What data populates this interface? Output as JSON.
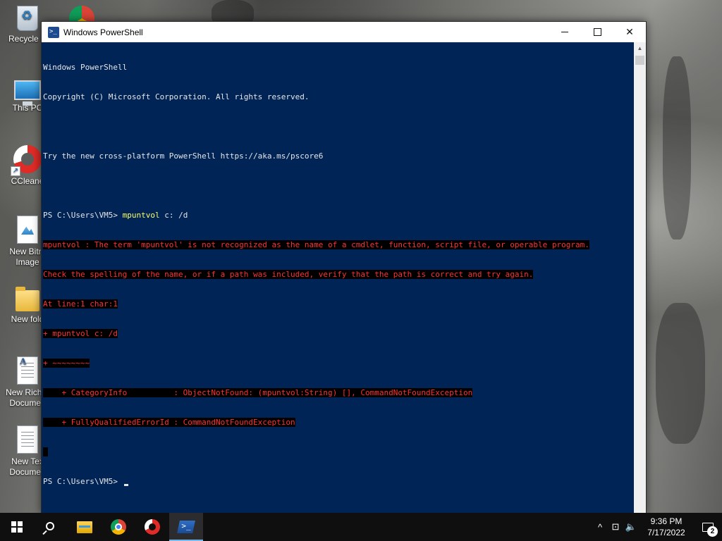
{
  "desktop": {
    "icons": [
      {
        "label": "Recycle B",
        "icon": "recycle-bin-icon"
      },
      {
        "label": "This PC",
        "icon": "computer-icon"
      },
      {
        "label": "CCleane",
        "icon": "ccleaner-icon"
      },
      {
        "label": "New Bitm\nImage",
        "icon": "bitmap-file-icon"
      },
      {
        "label": "New fold",
        "icon": "folder-icon"
      },
      {
        "label": "New Rich T\nDocumen",
        "icon": "rtf-document-icon"
      },
      {
        "label": "New Tex\nDocumen",
        "icon": "text-document-icon"
      }
    ]
  },
  "window": {
    "title": "Windows PowerShell",
    "controls": {
      "minimize": "minimize",
      "maximize": "maximize",
      "close": "✕"
    }
  },
  "console": {
    "banner_1": "Windows PowerShell",
    "banner_2": "Copyright (C) Microsoft Corporation. All rights reserved.",
    "banner_3": "",
    "banner_4": "Try the new cross-platform PowerShell https://aka.ms/pscore6",
    "banner_5": "",
    "prompt_1": "PS C:\\Users\\VM5> ",
    "command_name": "mpuntvol",
    "command_args": " c: /d",
    "error_1": "mpuntvol : The term 'mpuntvol' is not recognized as the name of a cmdlet, function, script file, or operable program.",
    "error_2": "Check the spelling of the name, or if a path was included, verify that the path is correct and try again.",
    "error_3": "At line:1 char:1",
    "error_4": "+ mpuntvol c: /d",
    "error_5": "+ ~~~~~~~~",
    "error_6": "    + CategoryInfo          : ObjectNotFound: (mpuntvol:String) [], CommandNotFoundException",
    "error_7": "    + FullyQualifiedErrorId : CommandNotFoundException",
    "error_8": " ",
    "prompt_2": "PS C:\\Users\\VM5> "
  },
  "taskbar": {
    "apps": [
      {
        "name": "start",
        "icon": "windows-start-icon"
      },
      {
        "name": "search",
        "icon": "search-icon"
      },
      {
        "name": "file-explorer",
        "icon": "file-explorer-icon"
      },
      {
        "name": "chrome",
        "icon": "chrome-icon"
      },
      {
        "name": "ccleaner",
        "icon": "ccleaner-icon"
      },
      {
        "name": "powershell",
        "icon": "powershell-icon",
        "active": true
      }
    ],
    "tray": {
      "chevron": "^",
      "network": "⊡",
      "volume": "🔈",
      "time": "9:36 PM",
      "date": "7/17/2022",
      "notification_count": "2"
    }
  },
  "colors": {
    "console_bg": "#012456",
    "console_fg": "#e6e6e6",
    "error_fg": "#ff3030",
    "error_bg": "#000000",
    "command_highlight": "#ffff66",
    "taskbar_active_underline": "#76b9ed"
  }
}
